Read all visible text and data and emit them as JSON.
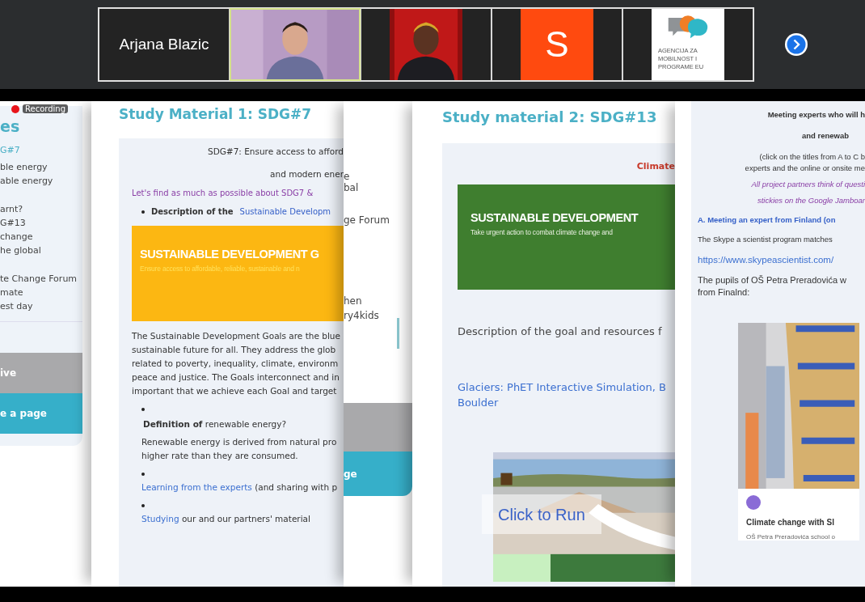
{
  "participants": [
    {
      "kind": "name",
      "name": "Arjana Blazic",
      "speaking": false
    },
    {
      "kind": "picture",
      "speaking": true
    },
    {
      "kind": "picture",
      "speaking": false
    },
    {
      "kind": "avatar",
      "letter": "S",
      "color": "#ff4a0f",
      "speaking": false
    },
    {
      "kind": "logo",
      "lines": [
        "AGENCIJA ZA",
        "MOBILNOST I",
        "PROGRAME EU"
      ],
      "speaking": false
    }
  ],
  "recording": {
    "label": "Recording"
  },
  "page_1": {
    "title": "es",
    "items": [
      "G#7",
      "ble energy",
      "able energy",
      "arnt?",
      "G#13",
      "change",
      "he global",
      "te Change Forum",
      "mate",
      "est day"
    ],
    "buttons": [
      {
        "kind": "grey",
        "label": "ive"
      },
      {
        "kind": "teal",
        "label": "e a page"
      }
    ]
  },
  "page_2": {
    "title": "Study Material 1: SDG#7",
    "intro": [
      "SDG#7: Ensure access to afford",
      "and modern ener"
    ],
    "call": "Let's find as much as possible about SDG7 &",
    "bullet_text": "Description of the ",
    "bullet_link": "Sustainable Developm",
    "banner": {
      "title": "SUSTAINABLE DEVELOPMENT G",
      "subtitle": "Ensure access to affordable, reliable, sustainable and n"
    },
    "paragraph": [
      "The Sustainable Development Goals are the blue",
      "sustainable future for all. They address the glob",
      "related to poverty, inequality, climate, environm",
      "peace and justice. The Goals interconnect and in",
      "important that we achieve each Goal and target"
    ],
    "definition": "**Definition of** renewable energy?",
    "definition_text": [
      "Renewable energy is derived from natural pro",
      "higher rate than they are consumed."
    ],
    "links": [
      {
        "link": "Learning from the experts",
        "rest": " (and sharing with p"
      },
      {
        "link": "Studying",
        "rest": " our and our partners' material"
      }
    ]
  },
  "page_3": {
    "fragments": [
      "e",
      "bal",
      "ge Forum",
      "hen",
      "ry4kids"
    ],
    "button": "ge"
  },
  "page_4": {
    "title": "Study material 2: SDG#13",
    "tag": "Climate",
    "banner": {
      "title": "SUSTAINABLE DEVELOPMENT",
      "subtitle": "Take urgent action to combat climate change and"
    },
    "description": "Description of the goal and resources f",
    "link": [
      "Glaciers: PhET Interactive Simulation, B",
      "Boulder"
    ],
    "run_label": "Click to Run"
  },
  "page_5": {
    "heading": [
      "Meeting experts who will h",
      "and renewab"
    ],
    "note": [
      "(click on the titles from A to  C b",
      "experts and the online or onsite me"
    ],
    "partners": [
      "All project partners think of questi",
      "stickies on the Google Jamboar"
    ],
    "section": "A. Meeting an expert from Finland (on",
    "skype": "The Skype a scientist program matches",
    "url": "https://www.skypeascientist.com/",
    "pupils": [
      "The pupils of OŠ Petra Preradovića w",
      "from Finalnd:"
    ],
    "card_title": "Climate change with Sl",
    "card_school": "OŠ Petra Preradovića school o"
  }
}
